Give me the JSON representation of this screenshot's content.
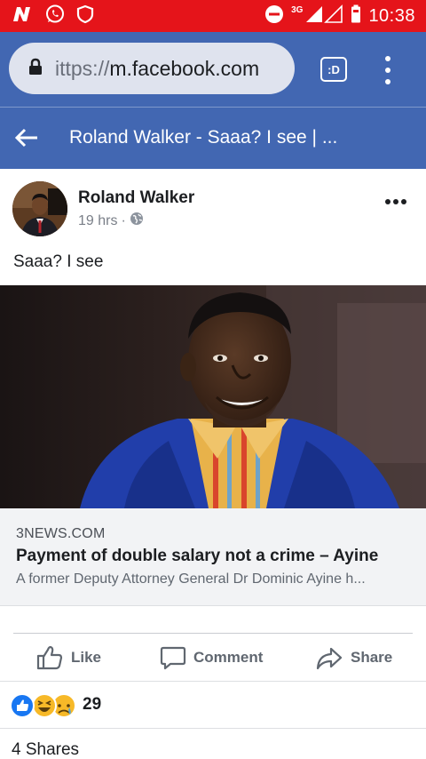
{
  "status_bar": {
    "network": "3G",
    "time": "10:38"
  },
  "browser": {
    "url_visible": "ittps://",
    "url_domain": "m.facebook.com",
    "tabs_label": ":D"
  },
  "page_header": {
    "title": "Roland Walker - Saaa? I see | ..."
  },
  "post": {
    "author": "Roland Walker",
    "time": "19 hrs",
    "separator": "·",
    "text": "Saaa? I see",
    "link": {
      "source": "3NEWS.COM",
      "title": "Payment of double salary not a crime – Ayine",
      "description": "A former Deputy Attorney General Dr Dominic Ayine h..."
    },
    "actions": {
      "like": "Like",
      "comment": "Comment",
      "share": "Share"
    },
    "reaction_count": "29",
    "shares": "4 Shares"
  },
  "colors": {
    "status_bar": "#e5141a",
    "facebook_blue": "#4267b2",
    "like_blue": "#1877f2",
    "haha_yellow": "#f7b928"
  },
  "icons": [
    "n-icon",
    "whatsapp-icon",
    "shield-icon",
    "dnd-icon",
    "signal-icon",
    "battery-icon",
    "lock-icon",
    "tabs-icon",
    "menu-icon",
    "back-arrow-icon",
    "globe-icon",
    "more-icon",
    "like-icon",
    "comment-icon",
    "share-icon",
    "like-reaction-icon",
    "haha-reaction-icon",
    "sad-reaction-icon"
  ]
}
